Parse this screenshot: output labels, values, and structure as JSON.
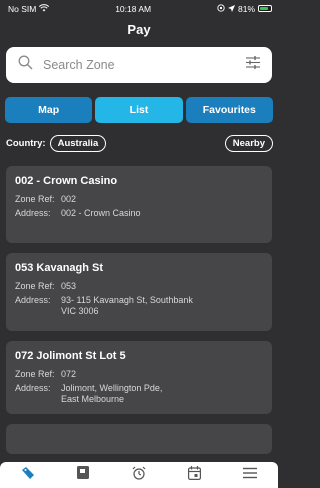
{
  "status": {
    "carrier": "No SIM",
    "time": "10:18 AM",
    "battery": "81%",
    "battery_level": 0.81,
    "battery_color": "#35c759"
  },
  "header": {
    "title": "Pay"
  },
  "search": {
    "placeholder": "Search Zone",
    "icon": "search-icon",
    "filter_icon": "sliders-icon"
  },
  "tabs": [
    {
      "label": "Map",
      "color": "#1b7fbd"
    },
    {
      "label": "List",
      "color": "#25b6e8"
    },
    {
      "label": "Favourites",
      "color": "#1b7fbd"
    }
  ],
  "filters": {
    "country_label": "Country:",
    "country_value": "Australia",
    "nearby_label": "Nearby"
  },
  "zones": [
    {
      "title": "002 - Crown Casino",
      "zone_ref_label": "Zone Ref:",
      "zone_ref": "002",
      "address_label": "Address:",
      "address": "002 - Crown Casino",
      "address_line2": ""
    },
    {
      "title": "053 Kavanagh St",
      "zone_ref_label": "Zone Ref:",
      "zone_ref": "053",
      "address_label": "Address:",
      "address": "93- 115 Kavanagh St, Southbank",
      "address_line2": "VIC 3006"
    },
    {
      "title": "072 Jolimont St Lot 5",
      "zone_ref_label": "Zone Ref:",
      "zone_ref": "072",
      "address_label": "Address:",
      "address": "Jolimont, Wellington Pde,",
      "address_line2": "East Melbourne"
    }
  ],
  "bottom_nav": [
    {
      "icon": "pay-tag-icon",
      "active": true
    },
    {
      "icon": "parking-icon"
    },
    {
      "icon": "alarm-clock-icon"
    },
    {
      "icon": "calendar-icon"
    },
    {
      "icon": "menu-icon"
    }
  ],
  "colors": {
    "background": "#2f2f31",
    "card": "#464648",
    "accent": "#1b7fbd",
    "accent_light": "#25b6e8"
  }
}
